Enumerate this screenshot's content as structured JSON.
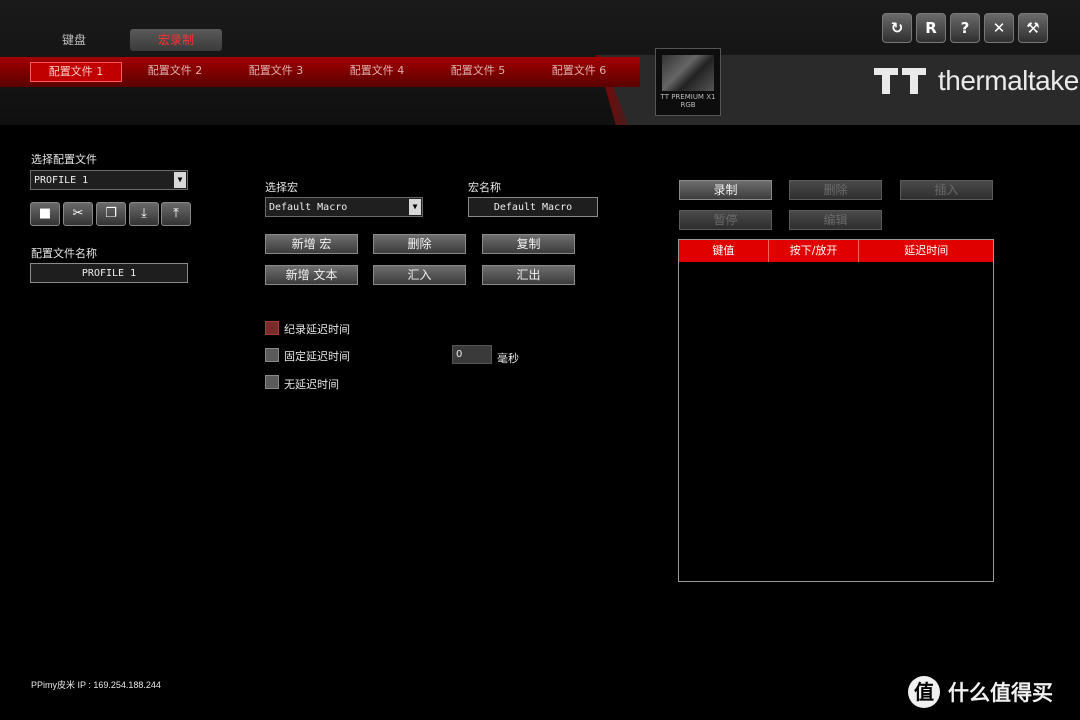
{
  "top_tabs": {
    "keyboard": "键盘",
    "macro": "宏录制"
  },
  "profile_tabs": [
    "配置文件 1",
    "配置文件 2",
    "配置文件 3",
    "配置文件 4",
    "配置文件 5",
    "配置文件 6"
  ],
  "device": {
    "name": "TT PREMIUM X1 RGB"
  },
  "brand": {
    "name": "thermaltake"
  },
  "top_buttons": [
    "refresh-icon",
    "reset-icon",
    "help-icon",
    "close-icon",
    "settings-icon"
  ],
  "left": {
    "select_profile_label": "选择配置文件",
    "profile_selected": "PROFILE 1",
    "profile_name_label": "配置文件名称",
    "profile_name_value": "PROFILE 1"
  },
  "macro": {
    "select_label": "选择宏",
    "select_value": "Default Macro",
    "name_label": "宏名称",
    "name_value": "Default Macro",
    "buttons": {
      "new_macro": "新增 宏",
      "delete": "删除",
      "copy": "复制",
      "new_text": "新增 文本",
      "import": "汇入",
      "export": "汇出"
    },
    "delay_options": {
      "record": "纪录延迟时间",
      "fixed": "固定延迟时间",
      "none": "无延迟时间",
      "fixed_value": "0",
      "unit": "毫秒"
    }
  },
  "record_panel": {
    "record": "录制",
    "delete": "删除",
    "insert": "插入",
    "pause": "暂停",
    "edit": "编辑",
    "columns": [
      "键值",
      "按下/放开",
      "延迟时间"
    ]
  },
  "footer": {
    "ip": "PPimy皮米 IP : 169.254.188.244"
  },
  "watermark": {
    "icon_text": "值",
    "text": "什么值得买"
  },
  "colors": {
    "accent_red": "#e00000",
    "background": "#000000"
  }
}
